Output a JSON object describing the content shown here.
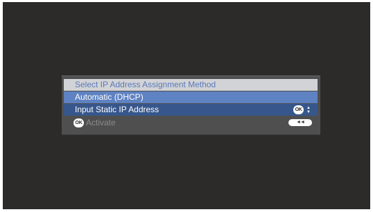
{
  "dialog": {
    "title": "Select IP Address Assignment Method",
    "options": [
      {
        "label": "Automatic (DHCP)",
        "selected": true
      },
      {
        "label": "Input Static IP Address",
        "selected": false
      }
    ],
    "ok_badge": "OK",
    "updown_up": "▲",
    "updown_down": "▼",
    "footer": {
      "ok_badge": "OK",
      "label": "Activate"
    },
    "back_glyph": "◄◄"
  },
  "colors": {
    "screen_bg": "#2c2b2a",
    "dialog_bg": "#4f4f4f",
    "title_bg": "#d2d3d6",
    "title_text": "#5a7ab8",
    "selected_row": "#5e82c2",
    "unselected_row": "#37578c"
  },
  "icons": {
    "ok": "ok-button-icon",
    "updown": "up-down-arrows-icon",
    "back": "back-arrows-icon"
  }
}
